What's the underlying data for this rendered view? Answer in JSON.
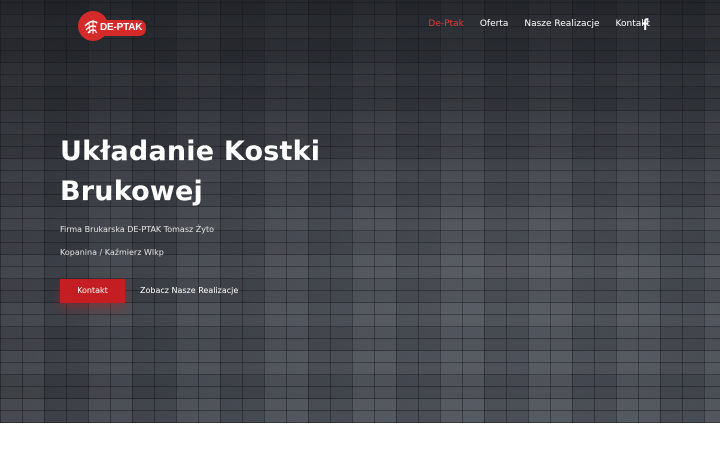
{
  "header": {
    "logo_text": "DE-PTAK",
    "nav": [
      {
        "label": "De-Ptak",
        "active": true
      },
      {
        "label": "Oferta",
        "active": false
      },
      {
        "label": "Nasze Realizacje",
        "active": false
      },
      {
        "label": "Kontakt",
        "active": false
      }
    ],
    "social_icon": "facebook-icon"
  },
  "hero": {
    "title_line1": "Układanie Kostki",
    "title_line2": "Brukowej",
    "subtitle_line1": "Firma Brukarska  DE-PTAK Tomasz Żyto",
    "subtitle_line2": "Kopanina / Kaźmierz Wlkp",
    "primary_button": "Kontakt",
    "secondary_link": "Zobacz Nasze Realizacje"
  },
  "colors": {
    "accent": "#c41e22",
    "nav_active": "#e03a3a",
    "logo_red": "#d42a2a"
  }
}
